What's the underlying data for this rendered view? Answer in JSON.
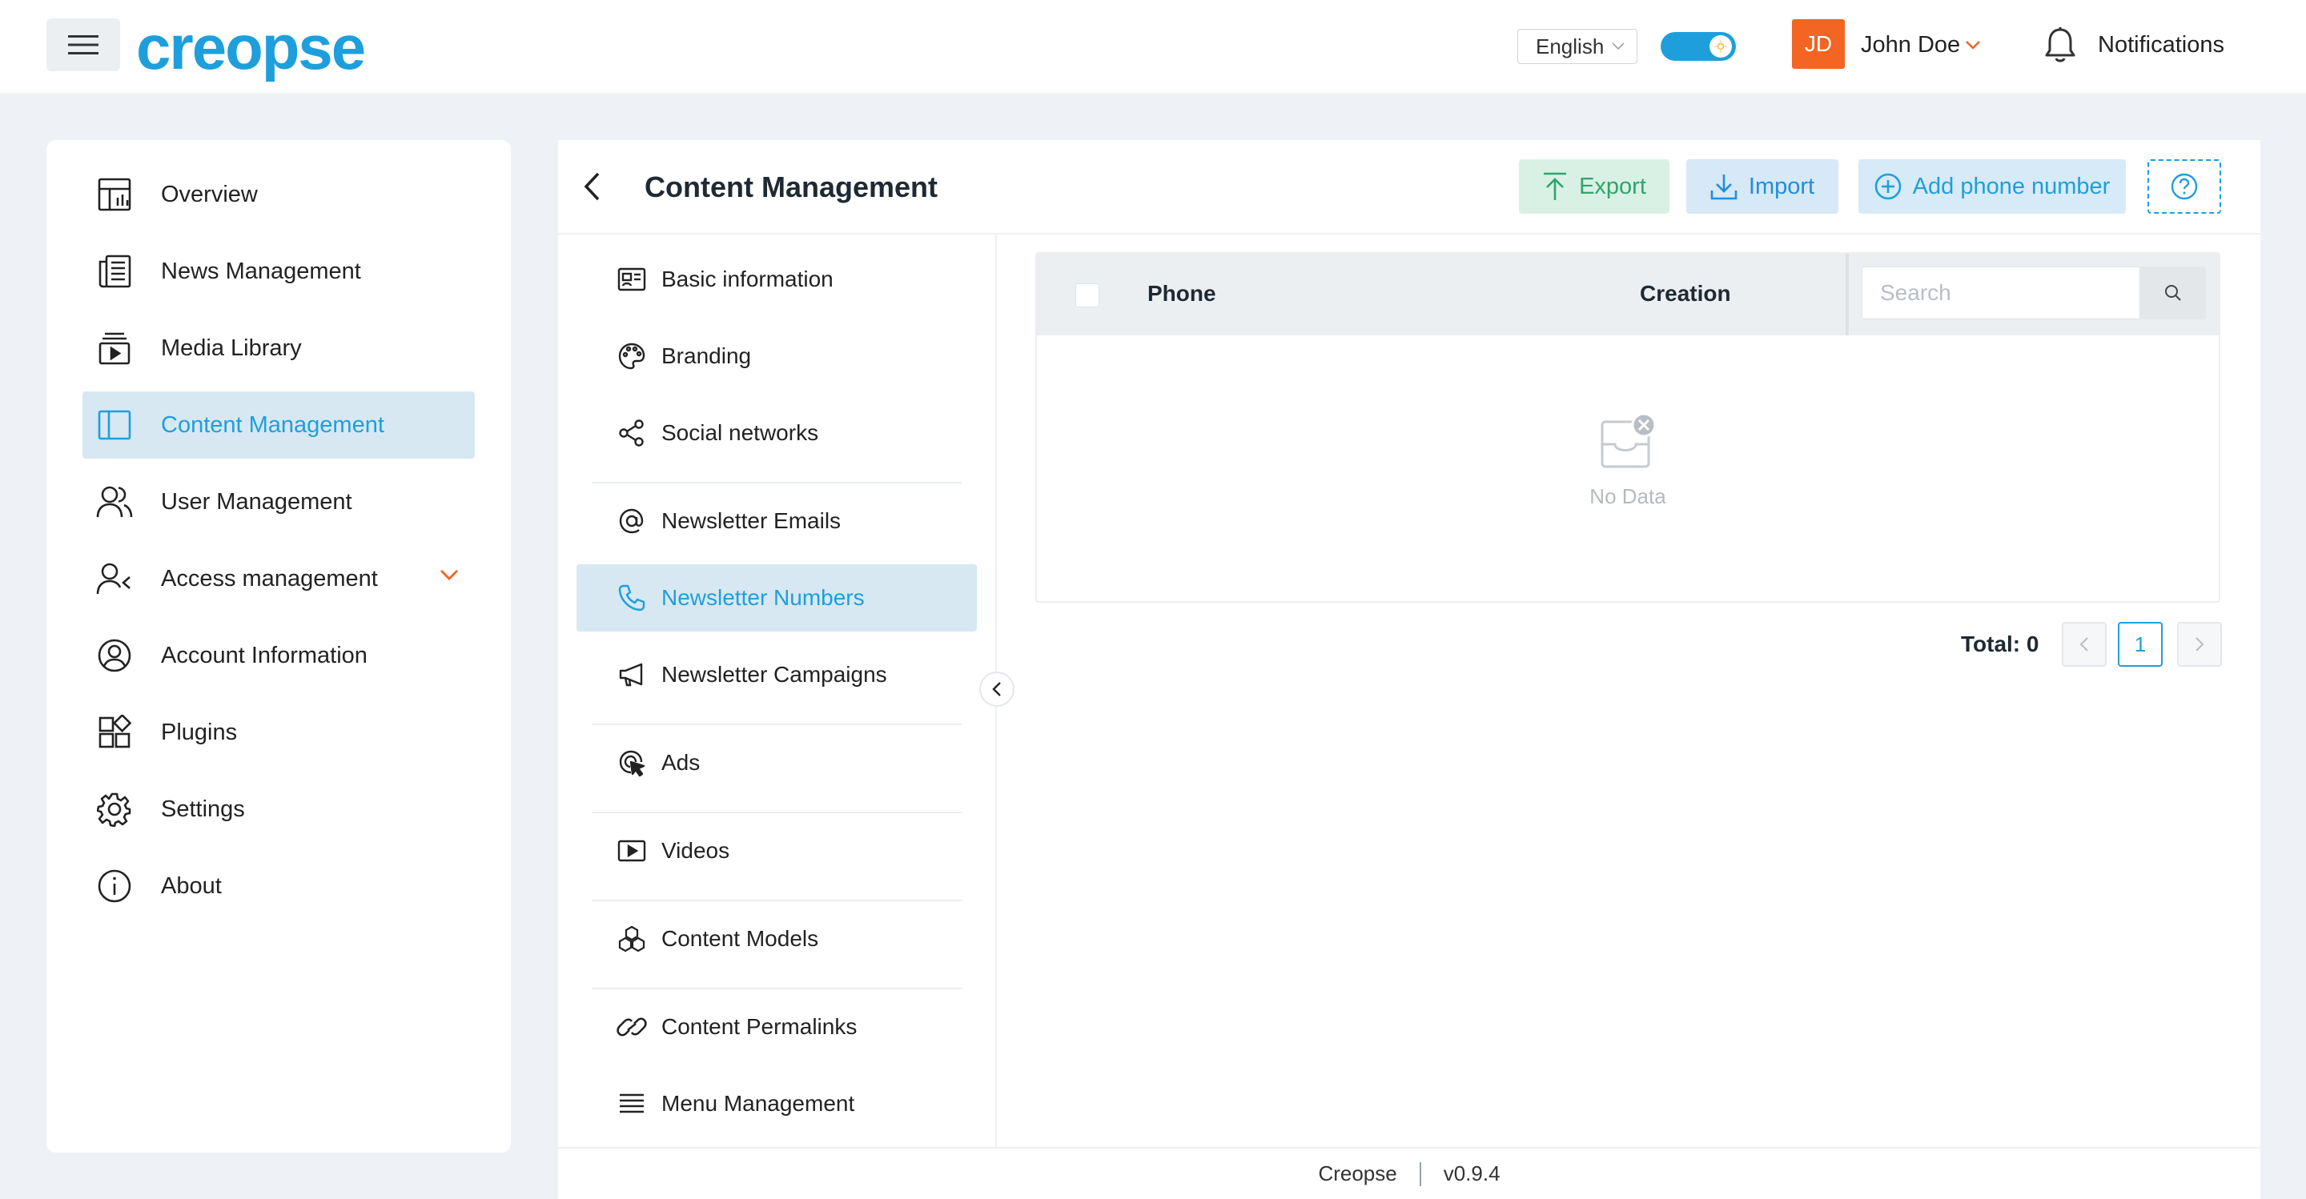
{
  "header": {
    "logo_text": "creopse",
    "language": "English",
    "avatar_initials": "JD",
    "user_name": "John Doe",
    "notifications_label": "Notifications"
  },
  "sidebar": {
    "items": [
      {
        "label": "Overview",
        "icon": "overview-icon"
      },
      {
        "label": "News Management",
        "icon": "news-icon"
      },
      {
        "label": "Media Library",
        "icon": "media-icon"
      },
      {
        "label": "Content Management",
        "icon": "content-icon",
        "active": true
      },
      {
        "label": "User Management",
        "icon": "users-icon"
      },
      {
        "label": "Access management",
        "icon": "access-icon",
        "expandable": true
      },
      {
        "label": "Account Information",
        "icon": "account-icon"
      },
      {
        "label": "Plugins",
        "icon": "plugins-icon"
      },
      {
        "label": "Settings",
        "icon": "gear-icon"
      },
      {
        "label": "About",
        "icon": "info-icon"
      }
    ]
  },
  "main": {
    "title": "Content Management",
    "buttons": {
      "export": "Export",
      "import": "Import",
      "add_phone": "Add phone number"
    },
    "submenu": [
      {
        "label": "Basic information",
        "icon": "id-card-icon"
      },
      {
        "label": "Branding",
        "icon": "palette-icon"
      },
      {
        "label": "Social networks",
        "icon": "share-icon"
      },
      {
        "label": "Newsletter Emails",
        "icon": "at-icon"
      },
      {
        "label": "Newsletter Numbers",
        "icon": "phone-icon",
        "active": true
      },
      {
        "label": "Newsletter Campaigns",
        "icon": "megaphone-icon"
      },
      {
        "label": "Ads",
        "icon": "target-icon"
      },
      {
        "label": "Videos",
        "icon": "video-icon"
      },
      {
        "label": "Content Models",
        "icon": "cubes-icon"
      },
      {
        "label": "Content Permalinks",
        "icon": "link-icon"
      },
      {
        "label": "Menu Management",
        "icon": "menu-icon"
      }
    ],
    "table": {
      "columns": [
        "Phone",
        "Creation"
      ],
      "search_placeholder": "Search",
      "empty_text": "No Data"
    },
    "pagination": {
      "total_label": "Total: 0",
      "current_page": "1"
    }
  },
  "footer": {
    "app_name": "Creopse",
    "version": "v0.9.4"
  },
  "colors": {
    "brand": "#1e9fdc",
    "accent": "#f26522",
    "export_green": "#2ea56a",
    "active_bg": "#d7e8f3"
  }
}
